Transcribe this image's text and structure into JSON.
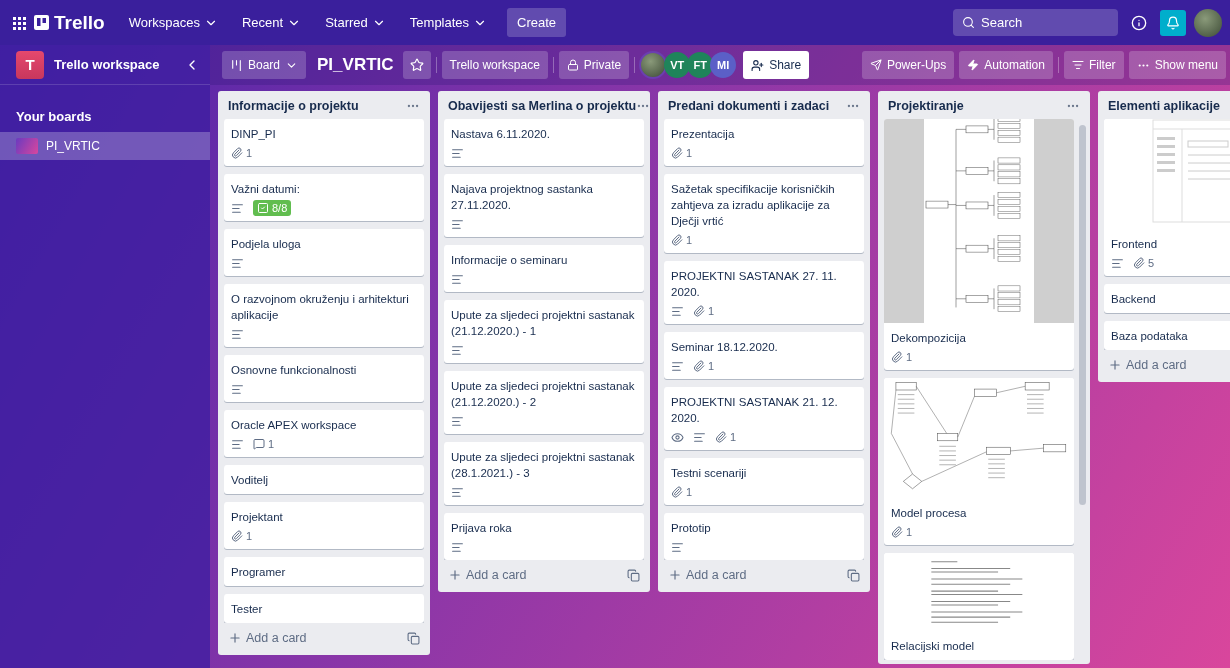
{
  "topbar": {
    "logo": "Trello",
    "menus": [
      {
        "label": "Workspaces"
      },
      {
        "label": "Recent"
      },
      {
        "label": "Starred"
      },
      {
        "label": "Templates"
      }
    ],
    "create": "Create",
    "search": {
      "placeholder": "Search"
    }
  },
  "sidebar": {
    "workspace_initial": "T",
    "workspace": "Trello workspace",
    "section": "Your boards",
    "boards": [
      {
        "label": "PI_VRTIC",
        "selected": true
      }
    ]
  },
  "board_header": {
    "view": "Board",
    "title": "PI_VRTIC",
    "starred": false,
    "workspace": "Trello workspace",
    "visibility": "Private",
    "members": [
      {
        "kind": "photo"
      },
      {
        "kind": "initials",
        "initials": "VT",
        "color": "#1f845a"
      },
      {
        "kind": "initials",
        "initials": "FT",
        "color": "#1f845a"
      },
      {
        "kind": "initials",
        "initials": "MI",
        "color": "#5b5fc7"
      }
    ],
    "share": "Share",
    "power_ups": "Power-Ups",
    "automation": "Automation",
    "filter": "Filter",
    "show_menu": "Show menu"
  },
  "lists": [
    {
      "title": "Informacije o projektu",
      "cards": [
        {
          "title": "DINP_PI",
          "badges": [
            {
              "kind": "attachment",
              "count": "1"
            }
          ]
        },
        {
          "title": "Važni datumi:",
          "badges": [
            {
              "kind": "description"
            },
            {
              "kind": "checklist",
              "count": "8/8",
              "complete": true
            }
          ]
        },
        {
          "title": "Podjela uloga",
          "badges": [
            {
              "kind": "description"
            }
          ]
        },
        {
          "title": "O razvojnom okruženju i arhitekturi aplikacije",
          "badges": [
            {
              "kind": "description"
            }
          ]
        },
        {
          "title": "Osnovne funkcionalnosti",
          "badges": [
            {
              "kind": "description"
            }
          ]
        },
        {
          "title": "Oracle APEX workspace",
          "badges": [
            {
              "kind": "description"
            },
            {
              "kind": "comment",
              "count": "1"
            }
          ]
        },
        {
          "title": "Voditelj"
        },
        {
          "title": "Projektant",
          "badges": [
            {
              "kind": "attachment",
              "count": "1"
            }
          ]
        },
        {
          "title": "Programer"
        },
        {
          "title": "Tester"
        }
      ],
      "add": "Add a card"
    },
    {
      "title": "Obavijesti sa Merlina o projektu",
      "cards": [
        {
          "title": "Nastava 6.11.2020.",
          "badges": [
            {
              "kind": "description"
            }
          ]
        },
        {
          "title": "Najava projektnog sastanka 27.11.2020.",
          "badges": [
            {
              "kind": "description"
            }
          ]
        },
        {
          "title": "Informacije o seminaru",
          "badges": [
            {
              "kind": "description"
            }
          ]
        },
        {
          "title": "Upute za sljedeci projektni sastanak (21.12.2020.) - 1",
          "badges": [
            {
              "kind": "description"
            }
          ]
        },
        {
          "title": "Upute za sljedeci projektni sastanak (21.12.2020.) - 2",
          "badges": [
            {
              "kind": "description"
            }
          ]
        },
        {
          "title": "Upute za sljedeci projektni sastanak (28.1.2021.) - 3",
          "badges": [
            {
              "kind": "description"
            }
          ]
        },
        {
          "title": "Prijava roka",
          "badges": [
            {
              "kind": "description"
            }
          ]
        }
      ],
      "add": "Add a card"
    },
    {
      "title": "Predani dokumenti i zadaci",
      "cards": [
        {
          "title": "Prezentacija",
          "badges": [
            {
              "kind": "attachment",
              "count": "1"
            }
          ]
        },
        {
          "title": "Sažetak specifikacije korisničkih zahtjeva za izradu aplikacije za Dječji vrtić",
          "badges": [
            {
              "kind": "attachment",
              "count": "1"
            }
          ]
        },
        {
          "title": "PROJEKTNI SASTANAK 27. 11. 2020.",
          "badges": [
            {
              "kind": "description"
            },
            {
              "kind": "attachment",
              "count": "1"
            }
          ]
        },
        {
          "title": "Seminar 18.12.2020.",
          "badges": [
            {
              "kind": "description"
            },
            {
              "kind": "attachment",
              "count": "1"
            }
          ]
        },
        {
          "title": "PROJEKTNI SASTANAK 21. 12. 2020.",
          "badges": [
            {
              "kind": "watch"
            },
            {
              "kind": "description"
            },
            {
              "kind": "attachment",
              "count": "1"
            }
          ]
        },
        {
          "title": "Testni scenariji",
          "badges": [
            {
              "kind": "attachment",
              "count": "1"
            }
          ]
        },
        {
          "title": "Prototip",
          "badges": [
            {
              "kind": "description"
            }
          ]
        }
      ],
      "add": "Add a card"
    },
    {
      "title": "Projektiranje",
      "scrollbar": true,
      "cards": [
        {
          "kind": "tree",
          "title": "Dekompozicija",
          "badges": [
            {
              "kind": "attachment",
              "count": "1"
            }
          ]
        },
        {
          "kind": "diagram",
          "title": "Model procesa",
          "badges": [
            {
              "kind": "attachment",
              "count": "1"
            }
          ]
        },
        {
          "kind": "document",
          "title": "Relacijski model"
        }
      ]
    },
    {
      "title": "Elementi aplikacije",
      "cards": [
        {
          "kind": "wireframe",
          "title": "Frontend",
          "badges": [
            {
              "kind": "description"
            },
            {
              "kind": "attachment",
              "count": "5"
            }
          ]
        },
        {
          "kind": "plain",
          "title": "Backend"
        },
        {
          "kind": "plain",
          "title": "Baza podataka"
        }
      ],
      "add": "Add a card"
    }
  ]
}
